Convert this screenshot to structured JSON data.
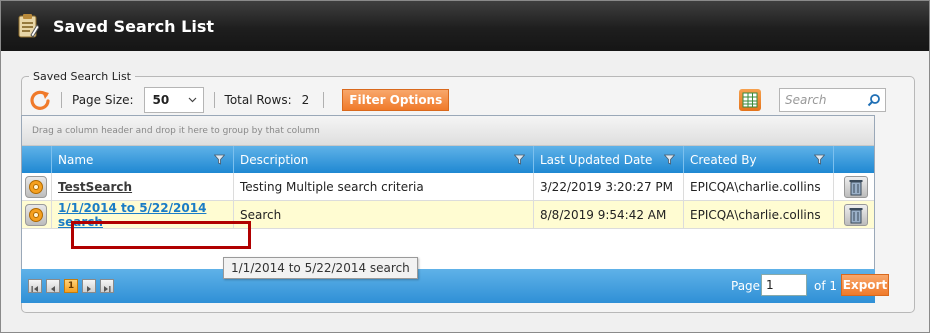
{
  "window": {
    "title": "Saved Search List"
  },
  "panel": {
    "legend": "Saved Search List"
  },
  "toolbar": {
    "page_size_label": "Page Size:",
    "page_size_value": "50",
    "total_rows_label": "Total Rows:",
    "total_rows_value": "2",
    "filter_options_label": "Filter Options",
    "search_placeholder": "Search"
  },
  "grid": {
    "group_panel_hint": "Drag a column header and drop it here to group by that column",
    "columns": [
      "Name",
      "Description",
      "Last Updated Date",
      "Created By"
    ],
    "rows": [
      {
        "name": "TestSearch",
        "description": "Testing Multiple search criteria",
        "last_updated": "3/22/2019 3:20:27 PM",
        "created_by": "EPICQA\\charlie.collins"
      },
      {
        "name": "1/1/2014 to 5/22/2014 search",
        "description": "Search",
        "last_updated": "8/8/2019 9:54:42 AM",
        "created_by": "EPICQA\\charlie.collins"
      }
    ]
  },
  "pager": {
    "current_page": "1",
    "page_label": "Page",
    "page_input_value": "1",
    "of_label": "of 1",
    "export_label": "Export"
  },
  "tooltip": {
    "text": "1/1/2014 to 5/22/2014 search"
  },
  "colors": {
    "header_blue": "#1f88d2",
    "accent_orange": "#f07a2a",
    "selected_row": "#fffcd2",
    "highlight_red": "#b00000",
    "link_blue": "#1a7cc6"
  }
}
